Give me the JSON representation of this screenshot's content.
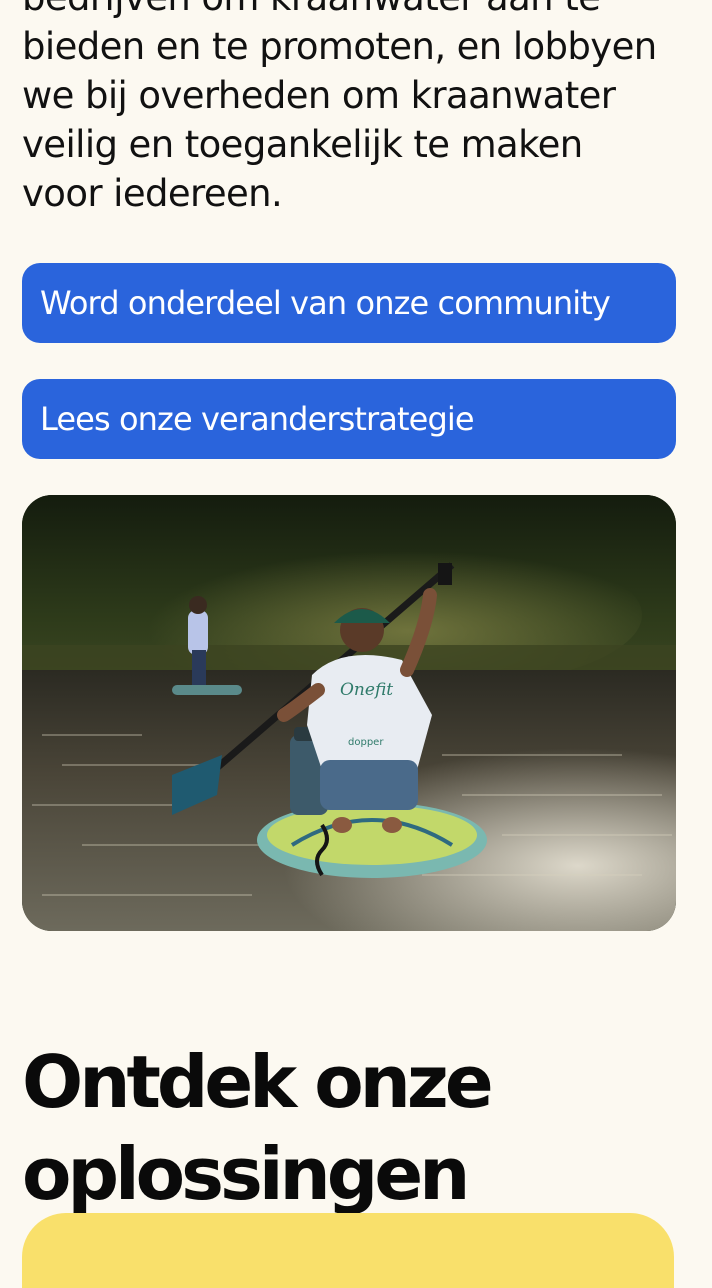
{
  "intro": {
    "text": "bedrijven om kraanwater aan te\nbieden en te promoten, en lobbyen\nwe bij overheden om kraanwater\nveilig en toegankelijk te maken\nvoor iedereen."
  },
  "buttons": {
    "community_label": "Word onderdeel van onze community",
    "strategy_label": "Lees onze veranderstrategie"
  },
  "photo": {
    "shirt_text": "Onefit",
    "shirt_subtext": "dopper"
  },
  "solutions": {
    "heading": "Ontdek onze\noplossingen"
  },
  "colors": {
    "background": "#fcf9f1",
    "button": "#2a64dc",
    "card": "#f9e06b"
  }
}
